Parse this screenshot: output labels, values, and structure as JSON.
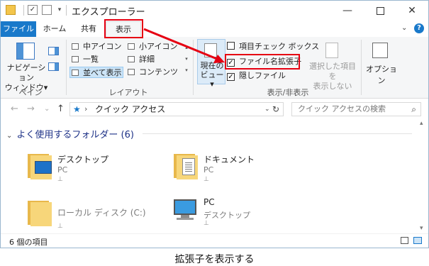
{
  "window": {
    "title": "エクスプローラー",
    "minimize_glyph": "—",
    "close_glyph": "✕"
  },
  "ribbon_tabs": [
    {
      "label": "ファイル"
    },
    {
      "label": "ホーム"
    },
    {
      "label": "共有"
    },
    {
      "label": "表示",
      "active": true
    }
  ],
  "ribbon": {
    "pane_group": {
      "label": "ペイン",
      "navigation_pane_line1": "ナビゲーション",
      "navigation_pane_line2": "ウィンドウ▾"
    },
    "layout_group": {
      "label": "レイアウト",
      "options": [
        {
          "label": "中アイコン"
        },
        {
          "label": "小アイコン"
        },
        {
          "label": "一覧"
        },
        {
          "label": "詳細"
        },
        {
          "label": "並べて表示",
          "selected": true
        },
        {
          "label": "コンテンツ"
        }
      ]
    },
    "current_view_group": {
      "label_line1": "現在の",
      "label_line2": "ビュー▾"
    },
    "show_hide_group": {
      "label": "表示/非表示",
      "checkboxes": [
        {
          "label": "項目チェック ボックス",
          "checked": false
        },
        {
          "label": "ファイル名拡張子",
          "checked": true
        },
        {
          "label": "隠しファイル",
          "checked": true
        }
      ],
      "hide_selected_line1": "選択した項目を",
      "hide_selected_line2": "表示しない"
    },
    "options_label": "オプション"
  },
  "address_bar": {
    "back": "←",
    "forward": "→",
    "dropdown": "⌄",
    "up": "↑",
    "path_label": "クイック アクセス"
  },
  "search": {
    "placeholder": "クイック アクセスの検索"
  },
  "content": {
    "section_title": "よく使用するフォルダー (6)",
    "items": [
      {
        "name": "デスクトップ",
        "subtitle": "PC",
        "icon": "desktop-folder-icon"
      },
      {
        "name": "ドキュメント",
        "subtitle": "PC",
        "icon": "documents-folder-icon"
      },
      {
        "name": "ローカル ディスク (C:)",
        "subtitle": "",
        "icon": "folder-icon"
      },
      {
        "name": "PC",
        "subtitle": "デスクトップ",
        "icon": "pc-icon"
      }
    ]
  },
  "status_bar": {
    "item_count": "6 個の項目"
  },
  "annotation": {
    "caption": "拡張子を表示する",
    "highlight_color": "#e60012"
  }
}
